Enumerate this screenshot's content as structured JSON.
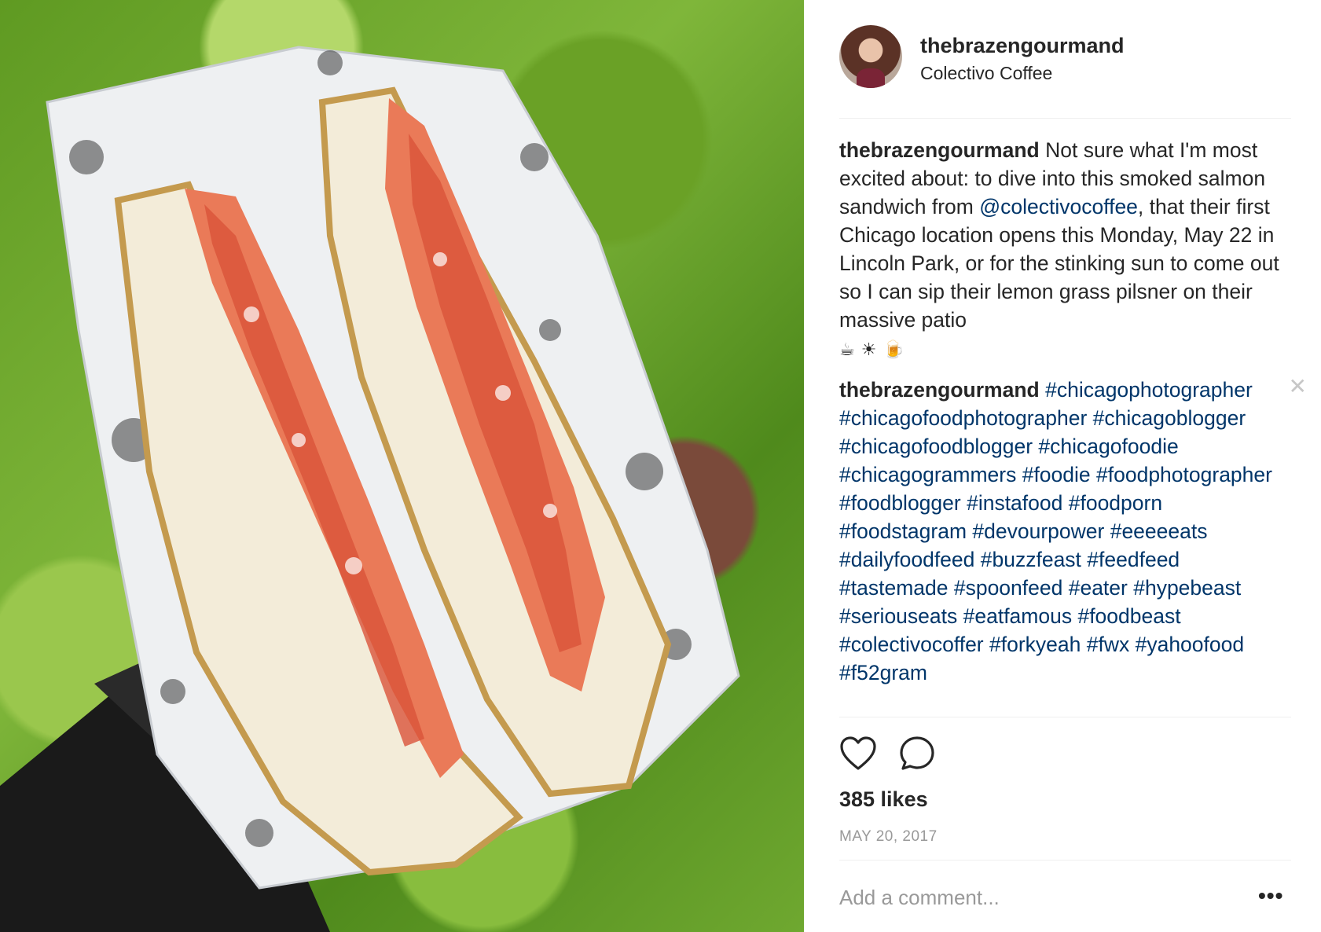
{
  "post": {
    "username": "thebrazengourmand",
    "location": "Colectivo Coffee"
  },
  "caption": {
    "username": "thebrazengourmand",
    "text_before_mention": "Not sure what I'm most excited about: to dive into this smoked salmon sandwich from ",
    "mention": "@colectivocoffee",
    "text_after_mention": ", that their first Chicago location opens this Monday, May 22 in Lincoln Park, or for the stinking sun to come out so I can sip their lemon grass pilsner on their massive patio",
    "emojis": "☕☀🍺"
  },
  "hashtag_comment": {
    "username": "thebrazengourmand",
    "tags": "#chicagophotographer #chicagofoodphotographer #chicagoblogger #chicagofoodblogger #chicagofoodie #chicagogrammers #foodie #foodphotographer #foodblogger #instafood #foodporn #foodstagram #devourpower #eeeeeats #dailyfoodfeed #buzzfeast #feedfeed #tastemade #spoonfeed #eater #hypebeast #seriouseats #eatfamous #foodbeast #colectivocoffer #forkyeah #fwx #yahoofood #f52gram",
    "close_glyph": "✕"
  },
  "engagement": {
    "likes": "385 likes",
    "date": "MAY 20, 2017"
  },
  "comment_box": {
    "placeholder": "Add a comment...",
    "more_glyph": "•••"
  },
  "icons": {
    "like": "heart-icon",
    "comment": "comment-bubble-icon"
  }
}
